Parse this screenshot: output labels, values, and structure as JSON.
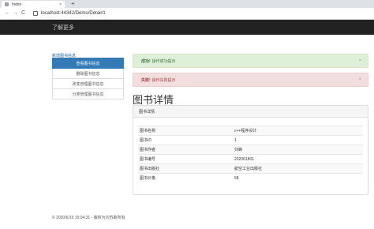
{
  "browser": {
    "tab_title": "Index",
    "tab_close": "×",
    "new_tab": "+",
    "back": "←",
    "forward": "→",
    "reload": "C",
    "url": "localhost:44342/Demo/Detail/1"
  },
  "site": {
    "brand": "了解更多"
  },
  "sidebar": {
    "top_link": "新增图书信息",
    "items": [
      {
        "label": "查看图书信息",
        "active": true
      },
      {
        "label": "删除图书信息"
      },
      {
        "label": "改变管理图书信息"
      },
      {
        "label": "分类管理图书信息"
      }
    ]
  },
  "alerts": {
    "success": {
      "strong": "成功!",
      "message": "操作成功提示",
      "close": "×"
    },
    "danger": {
      "strong": "失败!",
      "message": "操作失败提示",
      "close": "×"
    }
  },
  "main": {
    "title": "图书详情",
    "panel_title": "图书详情",
    "rows": [
      {
        "key": "图书名称",
        "value": "c++程序设计"
      },
      {
        "key": "图书ID",
        "value": "1"
      },
      {
        "key": "图书作者",
        "value": "刘峰"
      },
      {
        "key": "图书编号",
        "value": "202061801"
      },
      {
        "key": "图书出版社",
        "value": "航空工业出版社"
      },
      {
        "key": "图书价格",
        "value": "58"
      }
    ]
  },
  "footer": {
    "text": "© 2020/6/19 15:04:31 - 版权为刘苏斯所有"
  },
  "colors": {
    "header_bg": "#222222",
    "active_menu": "#337ab7",
    "success_bg": "#dff0d8",
    "danger_bg": "#f2dede"
  }
}
